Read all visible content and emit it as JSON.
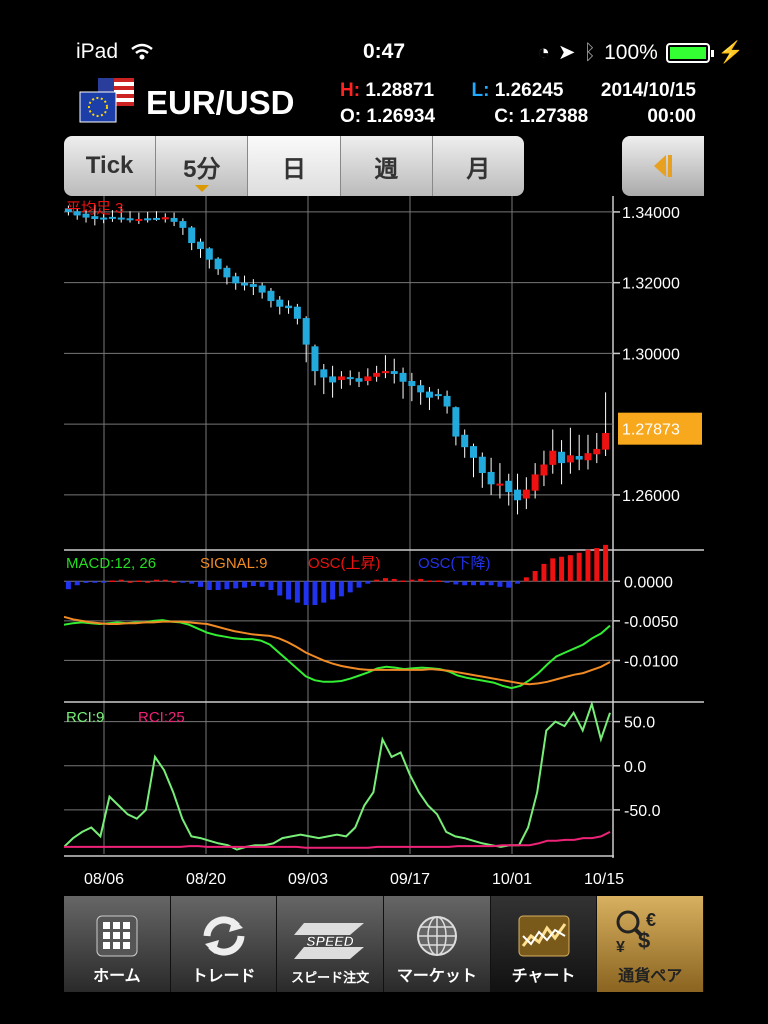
{
  "status": {
    "device": "iPad",
    "time": "0:47",
    "battery": "100%"
  },
  "header": {
    "pair": "EUR/USD",
    "high_label": "H:",
    "high": "1.28871",
    "low_label": "L:",
    "low": "1.26245",
    "date": "2014/10/15",
    "open_label": "O:",
    "open": "1.26934",
    "close_label": "C:",
    "close": "1.27388",
    "time": "00:00"
  },
  "timeframes": [
    "Tick",
    "5分",
    "日",
    "週",
    "月"
  ],
  "chart_data": [
    {
      "type": "candlestick",
      "title": "平均足 3",
      "y_ticks": [
        "1.34000",
        "1.32000",
        "1.30000",
        "1.26000"
      ],
      "ylim": [
        1.245,
        1.3445
      ],
      "current_price": "1.27873",
      "colors": {
        "up": "#ee1111",
        "down": "#22aadd",
        "price_tag": "#f7a81c"
      },
      "candles": [
        {
          "o": 1.341,
          "c": 1.34,
          "h": 1.3418,
          "l": 1.339
        },
        {
          "o": 1.3402,
          "c": 1.339,
          "h": 1.341,
          "l": 1.3378
        },
        {
          "o": 1.3395,
          "c": 1.3384,
          "h": 1.3405,
          "l": 1.337
        },
        {
          "o": 1.3388,
          "c": 1.338,
          "h": 1.342,
          "l": 1.3362
        },
        {
          "o": 1.3384,
          "c": 1.3382,
          "h": 1.341,
          "l": 1.3368
        },
        {
          "o": 1.3386,
          "c": 1.3383,
          "h": 1.3405,
          "l": 1.3372
        },
        {
          "o": 1.3384,
          "c": 1.338,
          "h": 1.3415,
          "l": 1.337
        },
        {
          "o": 1.3382,
          "c": 1.338,
          "h": 1.3402,
          "l": 1.337
        },
        {
          "o": 1.338,
          "c": 1.338,
          "h": 1.3398,
          "l": 1.3366
        },
        {
          "o": 1.3382,
          "c": 1.3381,
          "h": 1.34,
          "l": 1.337
        },
        {
          "o": 1.3383,
          "c": 1.3382,
          "h": 1.3402,
          "l": 1.3375
        },
        {
          "o": 1.3379,
          "c": 1.3385,
          "h": 1.3396,
          "l": 1.337
        },
        {
          "o": 1.3383,
          "c": 1.3372,
          "h": 1.3398,
          "l": 1.336
        },
        {
          "o": 1.3374,
          "c": 1.3355,
          "h": 1.3382,
          "l": 1.3335
        },
        {
          "o": 1.3356,
          "c": 1.3312,
          "h": 1.336,
          "l": 1.3292
        },
        {
          "o": 1.3316,
          "c": 1.3295,
          "h": 1.3325,
          "l": 1.327
        },
        {
          "o": 1.3297,
          "c": 1.3265,
          "h": 1.33,
          "l": 1.324
        },
        {
          "o": 1.3268,
          "c": 1.3238,
          "h": 1.3272,
          "l": 1.3222
        },
        {
          "o": 1.3242,
          "c": 1.3215,
          "h": 1.3248,
          "l": 1.3195
        },
        {
          "o": 1.3218,
          "c": 1.3198,
          "h": 1.3228,
          "l": 1.318
        },
        {
          "o": 1.32,
          "c": 1.3192,
          "h": 1.322,
          "l": 1.3178
        },
        {
          "o": 1.3196,
          "c": 1.3188,
          "h": 1.321,
          "l": 1.3165
        },
        {
          "o": 1.3192,
          "c": 1.3172,
          "h": 1.32,
          "l": 1.3155
        },
        {
          "o": 1.3177,
          "c": 1.3148,
          "h": 1.3185,
          "l": 1.313
        },
        {
          "o": 1.3152,
          "c": 1.3132,
          "h": 1.3162,
          "l": 1.311
        },
        {
          "o": 1.3135,
          "c": 1.3128,
          "h": 1.315,
          "l": 1.3112
        },
        {
          "o": 1.3132,
          "c": 1.3098,
          "h": 1.314,
          "l": 1.3082
        },
        {
          "o": 1.31,
          "c": 1.3025,
          "h": 1.3105,
          "l": 1.2975
        },
        {
          "o": 1.302,
          "c": 1.295,
          "h": 1.3025,
          "l": 1.291
        },
        {
          "o": 1.2955,
          "c": 1.2932,
          "h": 1.297,
          "l": 1.2885
        },
        {
          "o": 1.2935,
          "c": 1.2918,
          "h": 1.2965,
          "l": 1.2875
        },
        {
          "o": 1.2925,
          "c": 1.2935,
          "h": 1.295,
          "l": 1.29
        },
        {
          "o": 1.2933,
          "c": 1.293,
          "h": 1.2952,
          "l": 1.291
        },
        {
          "o": 1.293,
          "c": 1.292,
          "h": 1.2948,
          "l": 1.2905
        },
        {
          "o": 1.2922,
          "c": 1.2935,
          "h": 1.2958,
          "l": 1.291
        },
        {
          "o": 1.2934,
          "c": 1.2945,
          "h": 1.2965,
          "l": 1.292
        },
        {
          "o": 1.2945,
          "c": 1.295,
          "h": 1.2995,
          "l": 1.293
        },
        {
          "o": 1.295,
          "c": 1.2942,
          "h": 1.2985,
          "l": 1.2915
        },
        {
          "o": 1.2945,
          "c": 1.292,
          "h": 1.296,
          "l": 1.2872
        },
        {
          "o": 1.2922,
          "c": 1.2908,
          "h": 1.2945,
          "l": 1.2865
        },
        {
          "o": 1.291,
          "c": 1.289,
          "h": 1.2925,
          "l": 1.2855
        },
        {
          "o": 1.2892,
          "c": 1.2875,
          "h": 1.2905,
          "l": 1.284
        },
        {
          "o": 1.2885,
          "c": 1.288,
          "h": 1.29,
          "l": 1.287
        },
        {
          "o": 1.288,
          "c": 1.285,
          "h": 1.2895,
          "l": 1.283
        },
        {
          "o": 1.2848,
          "c": 1.2765,
          "h": 1.285,
          "l": 1.274
        },
        {
          "o": 1.277,
          "c": 1.2735,
          "h": 1.2785,
          "l": 1.2705
        },
        {
          "o": 1.2738,
          "c": 1.2705,
          "h": 1.2745,
          "l": 1.265
        },
        {
          "o": 1.2708,
          "c": 1.2662,
          "h": 1.272,
          "l": 1.262
        },
        {
          "o": 1.2665,
          "c": 1.263,
          "h": 1.2705,
          "l": 1.26
        },
        {
          "o": 1.2632,
          "c": 1.2632,
          "h": 1.269,
          "l": 1.259
        },
        {
          "o": 1.264,
          "c": 1.2608,
          "h": 1.266,
          "l": 1.257
        },
        {
          "o": 1.2615,
          "c": 1.2585,
          "h": 1.266,
          "l": 1.2545
        },
        {
          "o": 1.259,
          "c": 1.2615,
          "h": 1.265,
          "l": 1.256
        },
        {
          "o": 1.2612,
          "c": 1.2658,
          "h": 1.269,
          "l": 1.259
        },
        {
          "o": 1.2655,
          "c": 1.2686,
          "h": 1.2725,
          "l": 1.2625
        },
        {
          "o": 1.2685,
          "c": 1.2725,
          "h": 1.2785,
          "l": 1.266
        },
        {
          "o": 1.2722,
          "c": 1.269,
          "h": 1.2755,
          "l": 1.263
        },
        {
          "o": 1.2692,
          "c": 1.2712,
          "h": 1.279,
          "l": 1.266
        },
        {
          "o": 1.271,
          "c": 1.27,
          "h": 1.277,
          "l": 1.267
        },
        {
          "o": 1.2698,
          "c": 1.2718,
          "h": 1.277,
          "l": 1.2672
        },
        {
          "o": 1.2715,
          "c": 1.273,
          "h": 1.2775,
          "l": 1.269
        },
        {
          "o": 1.2728,
          "c": 1.2775,
          "h": 1.289,
          "l": 1.271
        }
      ]
    },
    {
      "type": "line",
      "title": "MACD",
      "legend": [
        "MACD:12, 26",
        "SIGNAL:9",
        "OSC(上昇)",
        "OSC(下降)"
      ],
      "legend_colors": [
        "#22dd22",
        "#f08a24",
        "#ee1111",
        "#2233ee"
      ],
      "y_ticks": [
        "0.0000",
        "-0.0050",
        "-0.0100"
      ],
      "ylim": [
        -0.015,
        0.0037
      ],
      "series": [
        {
          "name": "MACD:12, 26",
          "color": "#33ee33",
          "values": [
            -0.0055,
            -0.0053,
            -0.0052,
            -0.0053,
            -0.0054,
            -0.0053,
            -0.0052,
            -0.0053,
            -0.0052,
            -0.0052,
            -0.005,
            -0.0049,
            -0.0051,
            -0.0052,
            -0.0055,
            -0.006,
            -0.0065,
            -0.0068,
            -0.007,
            -0.0072,
            -0.0073,
            -0.0073,
            -0.0075,
            -0.008,
            -0.009,
            -0.01,
            -0.011,
            -0.012,
            -0.0125,
            -0.0127,
            -0.0127,
            -0.0126,
            -0.0123,
            -0.0119,
            -0.0115,
            -0.011,
            -0.0108,
            -0.0109,
            -0.0111,
            -0.011,
            -0.0109,
            -0.011,
            -0.0111,
            -0.0114,
            -0.0119,
            -0.0122,
            -0.0124,
            -0.0126,
            -0.0128,
            -0.0132,
            -0.0135,
            -0.0132,
            -0.0125,
            -0.0116,
            -0.0105,
            -0.0095,
            -0.009,
            -0.0085,
            -0.008,
            -0.0072,
            -0.0066,
            -0.0056
          ]
        },
        {
          "name": "SIGNAL:9",
          "color": "#f08a24",
          "values": [
            -0.0045,
            -0.0048,
            -0.005,
            -0.0052,
            -0.0053,
            -0.0054,
            -0.0054,
            -0.0053,
            -0.0053,
            -0.0052,
            -0.0052,
            -0.0051,
            -0.0051,
            -0.0051,
            -0.0052,
            -0.0053,
            -0.0054,
            -0.0057,
            -0.006,
            -0.0063,
            -0.0065,
            -0.0067,
            -0.0068,
            -0.0069,
            -0.0072,
            -0.0077,
            -0.0083,
            -0.009,
            -0.0095,
            -0.01,
            -0.0104,
            -0.0107,
            -0.0109,
            -0.0111,
            -0.0112,
            -0.0112,
            -0.0112,
            -0.0112,
            -0.0112,
            -0.0112,
            -0.0112,
            -0.0111,
            -0.0112,
            -0.0113,
            -0.0115,
            -0.0117,
            -0.0119,
            -0.0121,
            -0.0123,
            -0.0125,
            -0.0127,
            -0.0129,
            -0.013,
            -0.0129,
            -0.0127,
            -0.0124,
            -0.0121,
            -0.0118,
            -0.0116,
            -0.0112,
            -0.0108,
            -0.0102
          ]
        }
      ],
      "osc": [
        -0.001,
        -0.0005,
        -0.0002,
        -0.0001,
        -0.0001,
        0.0001,
        0.0002,
        0.0,
        0.0001,
        0.0,
        0.0002,
        0.0002,
        0.0,
        -0.0001,
        -0.0003,
        -0.0007,
        -0.0011,
        -0.0011,
        -0.001,
        -0.0009,
        -0.0008,
        -0.0006,
        -0.0007,
        -0.0011,
        -0.0018,
        -0.0023,
        -0.0027,
        -0.003,
        -0.003,
        -0.0027,
        -0.0023,
        -0.0019,
        -0.0014,
        -0.0008,
        -0.0003,
        0.0002,
        0.0004,
        0.0003,
        0.0001,
        0.0002,
        0.0003,
        0.0001,
        0.0001,
        -0.0001,
        -0.0004,
        -0.0005,
        -0.0005,
        -0.0005,
        -0.0005,
        -0.0007,
        -0.0008,
        -0.0003,
        0.0005,
        0.0013,
        0.0022,
        0.0029,
        0.0031,
        0.0033,
        0.0036,
        0.004,
        0.0042,
        0.0046
      ]
    },
    {
      "type": "line",
      "title": "RCI",
      "y_ticks": [
        "50.0",
        "0.0",
        "-50.0"
      ],
      "ylim": [
        -100,
        70
      ],
      "series": [
        {
          "name": "RCI:9",
          "color": "#77ee77",
          "values": [
            -92,
            -82,
            -75,
            -70,
            -80,
            -35,
            -45,
            -55,
            -60,
            -50,
            10,
            -5,
            -30,
            -60,
            -80,
            -82,
            -85,
            -88,
            -90,
            -95,
            -92,
            -90,
            -90,
            -88,
            -82,
            -80,
            -78,
            -80,
            -82,
            -80,
            -78,
            -80,
            -70,
            -45,
            -30,
            30,
            10,
            15,
            -10,
            -30,
            -45,
            -55,
            -75,
            -80,
            -82,
            -85,
            -88,
            -90,
            -92,
            -90,
            -90,
            -70,
            -30,
            40,
            50,
            45,
            60,
            40,
            70,
            30,
            60
          ]
        },
        {
          "name": "RCI:25",
          "color": "#ee2277",
          "values": [
            -92,
            -92,
            -92,
            -92,
            -92,
            -92,
            -92,
            -92,
            -92,
            -92,
            -92,
            -92,
            -92,
            -92,
            -91,
            -91,
            -92,
            -92,
            -92,
            -92,
            -92,
            -92,
            -92,
            -92,
            -92,
            -92,
            -92,
            -93,
            -93,
            -93,
            -93,
            -93,
            -93,
            -93,
            -93,
            -92,
            -92,
            -92,
            -92,
            -92,
            -92,
            -92,
            -92,
            -92,
            -91,
            -91,
            -91,
            -91,
            -91,
            -90,
            -90,
            -90,
            -90,
            -88,
            -85,
            -85,
            -84,
            -84,
            -82,
            -82,
            -80,
            -75
          ]
        }
      ]
    }
  ],
  "x_labels": [
    "08/06",
    "08/20",
    "09/03",
    "09/17",
    "10/01",
    "10/15"
  ],
  "tabs": [
    {
      "label": "ホーム",
      "icon": "grid-icon"
    },
    {
      "label": "トレード",
      "icon": "refresh-icon"
    },
    {
      "label": "スピード注文",
      "icon": "speed-icon"
    },
    {
      "label": "マーケット",
      "icon": "globe-icon"
    },
    {
      "label": "チャート",
      "icon": "chart-icon"
    },
    {
      "label": "通貨ペア",
      "icon": "currency-icon"
    }
  ]
}
